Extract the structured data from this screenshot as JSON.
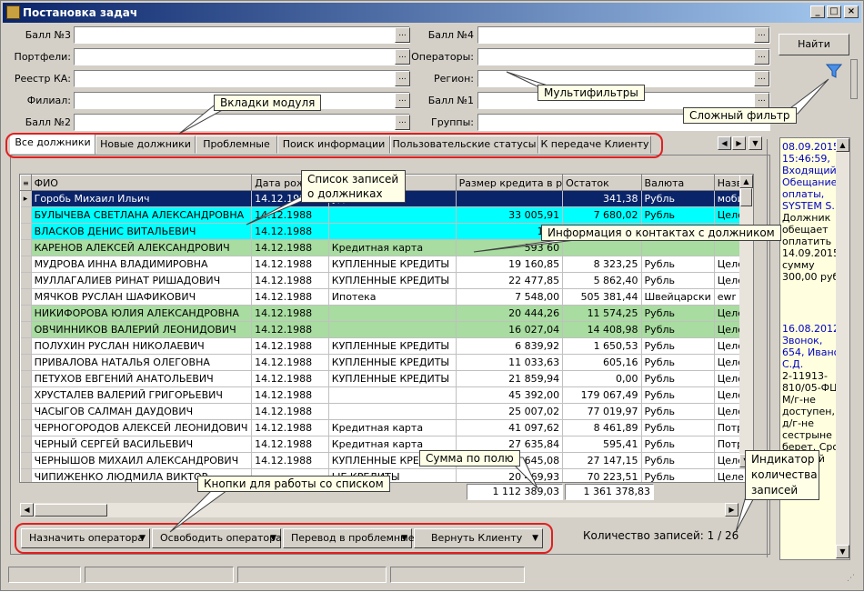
{
  "window": {
    "title": "Постановка задач",
    "min": "_",
    "max": "□",
    "close": "×"
  },
  "filters": {
    "left": [
      {
        "label": "Балл №3",
        "value": ""
      },
      {
        "label": "Портфели:",
        "value": ""
      },
      {
        "label": "Реестр КА:",
        "value": ""
      },
      {
        "label": "Филиал:",
        "value": ""
      },
      {
        "label": "Балл №2",
        "value": ""
      }
    ],
    "right": [
      {
        "label": "Балл №4",
        "value": ""
      },
      {
        "label": "Операторы:",
        "value": ""
      },
      {
        "label": "Регион:",
        "value": ""
      },
      {
        "label": "Балл №1",
        "value": ""
      },
      {
        "label": "Группы:",
        "value": ""
      }
    ],
    "ellipsis": "..."
  },
  "find_button": "Найти",
  "tabs": [
    "Все должники",
    "Новые должники",
    "Проблемные",
    "Поиск информации",
    "Пользовательские статусы",
    "К передаче Клиенту"
  ],
  "table": {
    "columns": [
      "ФИО",
      "Дата рож",
      "",
      "Размер кредита в р",
      "Остаток",
      "Валюта",
      "Назв"
    ],
    "rows": [
      {
        "name": "Горобь Михаил Ильич",
        "date": "14.12.1988",
        "type": "уды",
        "size": "",
        "rest": "341,38",
        "cur": "Рубль",
        "n": "моби",
        "bg": "sel"
      },
      {
        "name": "БУЛЫЧЕВА СВЕТЛАНА АЛЕКСАНДРОВНА",
        "date": "14.12.1988",
        "type": "",
        "size": "33 005,91",
        "rest": "7 680,02",
        "cur": "Рубль",
        "n": "Целе",
        "bg": "cyan"
      },
      {
        "name": "ВЛАСКОВ ДЕНИС ВИТАЛЬЕВИЧ",
        "date": "14.12.1988",
        "type": "",
        "size": "11 8",
        "rest": "",
        "cur": "",
        "n": "",
        "bg": "cyan"
      },
      {
        "name": "КАРЕНОВ АЛЕКСЕЙ АЛЕКСАНДРОВИЧ",
        "date": "14.12.1988",
        "type": "Кредитная карта",
        "size": "593 60",
        "rest": "",
        "cur": "",
        "n": "",
        "bg": "green"
      },
      {
        "name": "МУДРОВА ИННА ВЛАДИМИРОВНА",
        "date": "14.12.1988",
        "type": "КУПЛЕННЫЕ КРЕДИТЫ",
        "size": "19 160,85",
        "rest": "8 323,25",
        "cur": "Рубль",
        "n": "Целе",
        "bg": ""
      },
      {
        "name": "МУЛЛАГАЛИЕВ РИНАТ РИШАДОВИЧ",
        "date": "14.12.1988",
        "type": "КУПЛЕННЫЕ КРЕДИТЫ",
        "size": "22 477,85",
        "rest": "5 862,40",
        "cur": "Рубль",
        "n": "Целе",
        "bg": ""
      },
      {
        "name": "МЯЧКОВ РУСЛАН ШАФИКОВИЧ",
        "date": "14.12.1988",
        "type": "Ипотека",
        "size": "7 548,00",
        "rest": "505 381,44",
        "cur": "Швейцарски",
        "n": "ewr",
        "bg": ""
      },
      {
        "name": "НИКИФОРОВА ЮЛИЯ АЛЕКСАНДРОВНА",
        "date": "14.12.1988",
        "type": "",
        "size": "20 444,26",
        "rest": "11 574,25",
        "cur": "Рубль",
        "n": "Целе",
        "bg": "green"
      },
      {
        "name": "ОВЧИННИКОВ ВАЛЕРИЙ ЛЕОНИДОВИЧ",
        "date": "14.12.1988",
        "type": "",
        "size": "16 027,04",
        "rest": "14 408,98",
        "cur": "Рубль",
        "n": "Целе",
        "bg": "green"
      },
      {
        "name": "ПОЛУХИН РУСЛАН НИКОЛАЕВИЧ",
        "date": "14.12.1988",
        "type": "КУПЛЕННЫЕ КРЕДИТЫ",
        "size": "6 839,92",
        "rest": "1 650,53",
        "cur": "Рубль",
        "n": "Целе",
        "bg": ""
      },
      {
        "name": "ПРИВАЛОВА НАТАЛЬЯ ОЛЕГОВНА",
        "date": "14.12.1988",
        "type": "КУПЛЕННЫЕ КРЕДИТЫ",
        "size": "11 033,63",
        "rest": "605,16",
        "cur": "Рубль",
        "n": "Целе",
        "bg": ""
      },
      {
        "name": "ПЕТУХОВ ЕВГЕНИЙ АНАТОЛЬЕВИЧ",
        "date": "14.12.1988",
        "type": "КУПЛЕННЫЕ КРЕДИТЫ",
        "size": "21 859,94",
        "rest": "0,00",
        "cur": "Рубль",
        "n": "Целе",
        "bg": ""
      },
      {
        "name": "ХРУСТАЛЕВ ВАЛЕРИЙ ГРИГОРЬЕВИЧ",
        "date": "14.12.1988",
        "type": "",
        "size": "45 392,00",
        "rest": "179 067,49",
        "cur": "Рубль",
        "n": "Целе",
        "bg": ""
      },
      {
        "name": "ЧАСЫГОВ САЛМАН ДАУДОВИЧ",
        "date": "14.12.1988",
        "type": "",
        "size": "25 007,02",
        "rest": "77 019,97",
        "cur": "Рубль",
        "n": "Целе",
        "bg": ""
      },
      {
        "name": "ЧЕРНОГОРОДОВ АЛЕКСЕЙ ЛЕОНИДОВИЧ",
        "date": "14.12.1988",
        "type": "Кредитная карта",
        "size": "41 097,62",
        "rest": "8 461,89",
        "cur": "Рубль",
        "n": "Потре",
        "bg": ""
      },
      {
        "name": "ЧЕРНЫЙ СЕРГЕЙ ВАСИЛЬЕВИЧ",
        "date": "14.12.1988",
        "type": "Кредитная карта",
        "size": "27 635,84",
        "rest": "595,41",
        "cur": "Рубль",
        "n": "Потре",
        "bg": ""
      },
      {
        "name": "ЧЕРНЫШОВ МИХАИЛ АЛЕКСАНДРОВИЧ",
        "date": "14.12.1988",
        "type": "КУПЛЕННЫЕ КРЕДИТЫ",
        "size": "65 645,08",
        "rest": "27 147,15",
        "cur": "Рубль",
        "n": "Целе",
        "bg": ""
      },
      {
        "name": "ЧИПИЖЕНКО ЛЮДМИЛА ВИКТОР",
        "date": "",
        "type": "ЫЕ КРЕДИТЫ",
        "size": "20 469,93",
        "rest": "70 223,51",
        "cur": "Рубль",
        "n": "Целе",
        "bg": ""
      }
    ],
    "sum_size": "1 112 389,03",
    "sum_rest": "1 361 378,83"
  },
  "notes": {
    "n1": "08.09.2015 15:46:59, Входящий, Обещание оплаты, SYSTEM S.",
    "n1b": "Должник обещает оплатить 14.09.2015 сумму 300,00 руб",
    "n2": "16.08.2012 , Звонок, 654, Иванов С.Д.",
    "n2b": "2-11913-810/05-ФЦ; М/г-не доступен, д/г-не",
    "n2c": "сестрыне берет. Срок исковой"
  },
  "actions": [
    "Назначить оператора",
    "Освободить оператора",
    "Перевод в проблемные",
    "Вернуть Клиенту"
  ],
  "count_text": "Количество записей: 1 / 26",
  "callouts": {
    "tabs": "Вкладки модуля",
    "multifilters": "Мультифильтры",
    "complex": "Сложный фильтр",
    "list": "Список записей о должниках",
    "contacts": "Информация о контактах с должником",
    "sum": "Сумма по полю",
    "buttons": "Кнопки для работы со списком",
    "counter": "Индикатор количества записей"
  },
  "colors": {
    "selected": "#0a246a",
    "cyan": "#00ffff",
    "green": "#a8dca0",
    "callout_border": "#e02020"
  }
}
